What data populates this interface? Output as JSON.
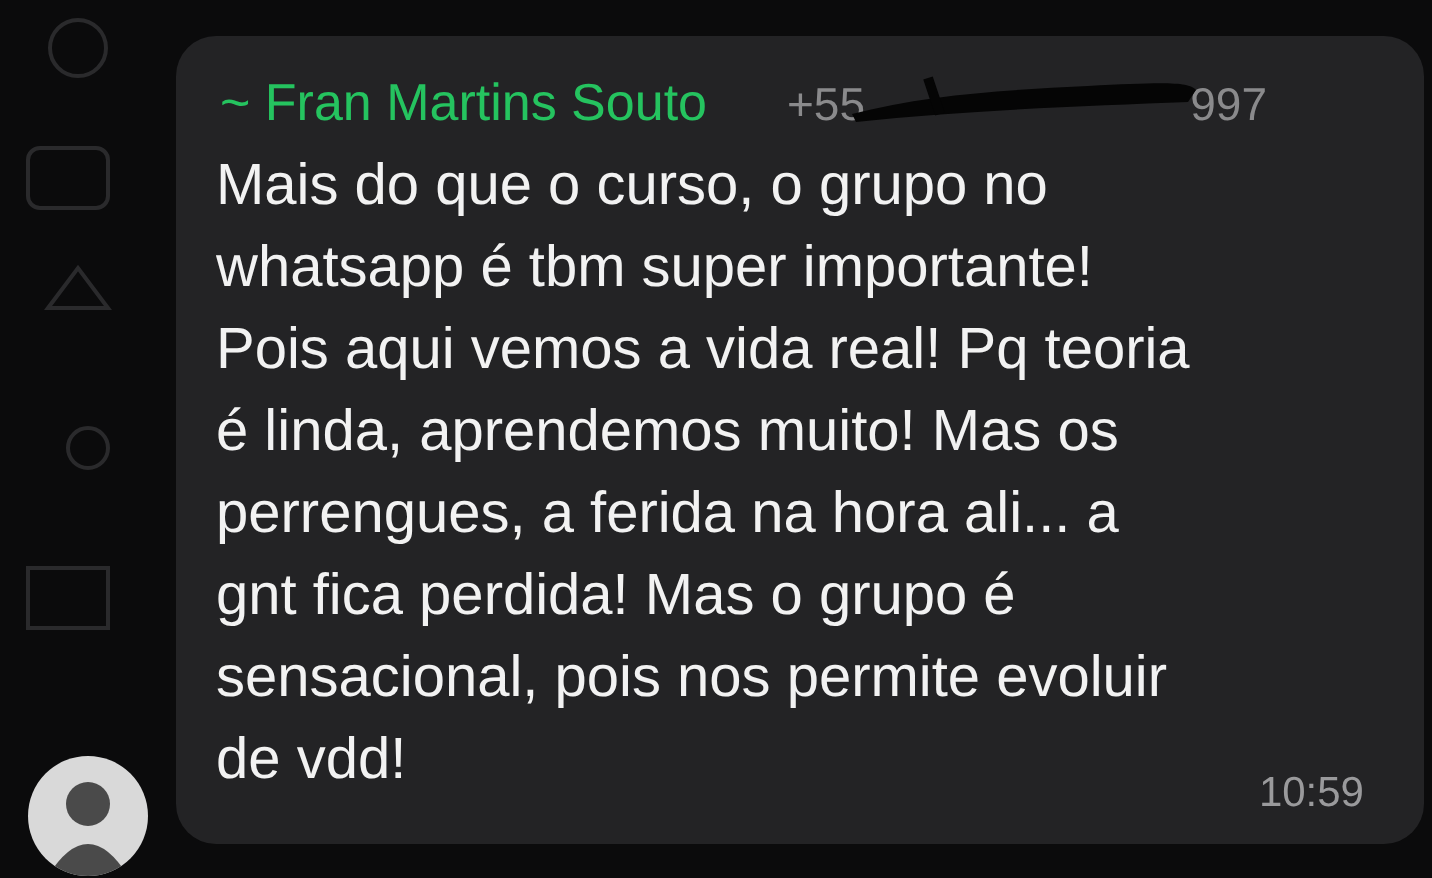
{
  "message": {
    "sender": "~ Fran Martins Souto",
    "phone_start": "+55",
    "phone_end": "997",
    "text": "Mais do que o curso, o grupo no\nwhatsapp é tbm super importante!\nPois aqui vemos a vida real! Pq teoria\né linda, aprendemos muito! Mas os\nperrengues, a ferida na hora ali... a\ngnt fica perdida! Mas o grupo é\nsensacional, pois nos permite evoluir\nde vdd!",
    "time": "10:59"
  }
}
